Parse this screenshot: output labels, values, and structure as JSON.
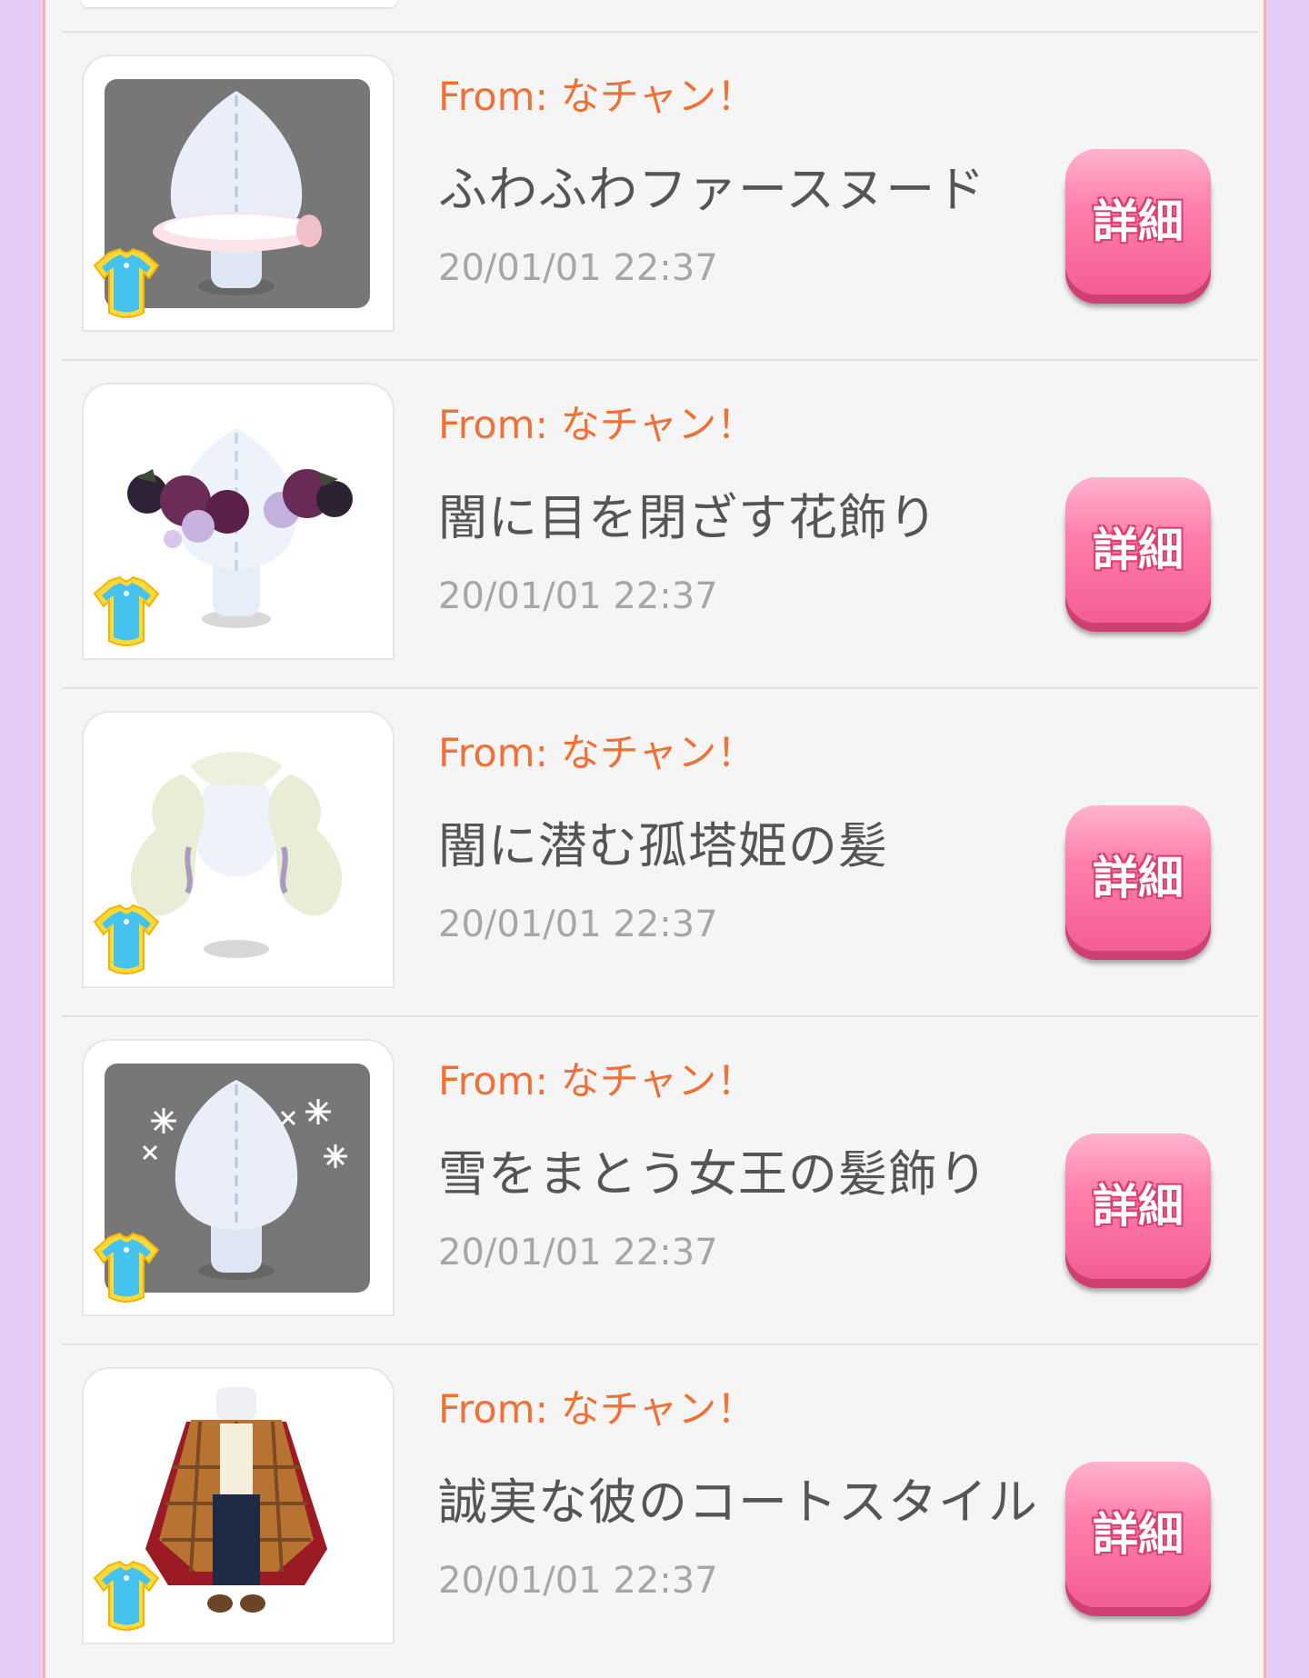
{
  "list": {
    "items": [
      {
        "from": "From: なチャン！",
        "title": "ふわふわファースヌード",
        "date": "20/01/01 22:37",
        "button": "詳細",
        "icon": "fur-snood-item-icon",
        "gray_bg": true
      },
      {
        "from": "From: なチャン！",
        "title": "闇に目を閉ざす花飾り",
        "date": "20/01/01 22:37",
        "button": "詳細",
        "icon": "flower-crown-item-icon",
        "gray_bg": false
      },
      {
        "from": "From: なチャン！",
        "title": "闇に潜む孤塔姫の髪",
        "date": "20/01/01 22:37",
        "button": "詳細",
        "icon": "twin-tail-hair-item-icon",
        "gray_bg": false
      },
      {
        "from": "From: なチャン！",
        "title": "雪をまとう女王の髪飾り",
        "date": "20/01/01 22:37",
        "button": "詳細",
        "icon": "snowflake-hair-ornament-item-icon",
        "gray_bg": true
      },
      {
        "from": "From: なチャン！",
        "title": "誠実な彼のコートスタイル",
        "date": "20/01/01 22:37",
        "button": "詳細",
        "icon": "coat-outfit-item-icon",
        "gray_bg": false
      }
    ]
  },
  "colors": {
    "from_text": "#ee7138",
    "title_text": "#555555",
    "date_text": "#a6a6a6",
    "button": "#ff7fac",
    "background": "#e4ccf7"
  }
}
